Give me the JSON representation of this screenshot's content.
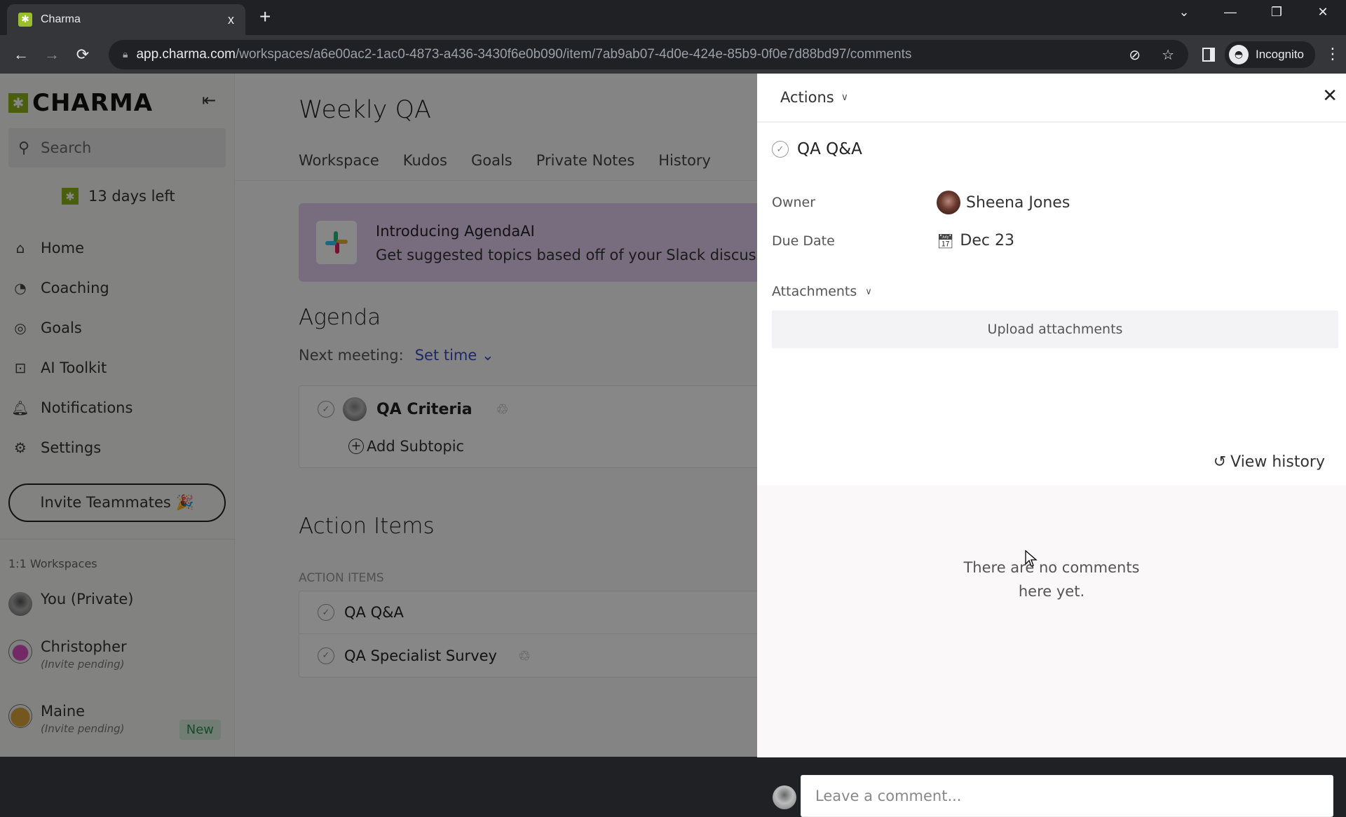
{
  "browser": {
    "tab_title": "Charma",
    "tab_close": "x",
    "new_tab": "+",
    "url_host": "app.charma.com",
    "url_path": "/workspaces/a6e00ac2-1ac0-4873-a436-3430f6e0b090/item/7ab9ab07-4d0e-424e-85b9-0f0e7d88bd97/comments",
    "profile_label": "Incognito",
    "window_controls": {
      "tabsearch": "⌄",
      "minimize": "—",
      "restore": "❐",
      "close": "✕"
    },
    "nav": {
      "back": "←",
      "forward": "→",
      "reload": "⟳"
    },
    "icons": {
      "eye_off": "⊘",
      "star": "☆",
      "menu": "⋮"
    }
  },
  "sidebar": {
    "logo": "CHARMA",
    "collapse_icon": "⇤",
    "search_placeholder": "Search",
    "trial": "13 days left",
    "nav_items": [
      {
        "label": "Home",
        "icon": "⌂"
      },
      {
        "label": "Coaching",
        "icon": "◔"
      },
      {
        "label": "Goals",
        "icon": "◎"
      },
      {
        "label": "AI Toolkit",
        "icon": "⊡"
      },
      {
        "label": "Notifications",
        "icon": "🔔︎"
      },
      {
        "label": "Settings",
        "icon": "⚙"
      }
    ],
    "invite_button": "Invite Teammates 🎉",
    "workspaces_heading": "1:1 Workspaces",
    "workspaces": [
      {
        "name": "You (Private)",
        "sub": "",
        "badge": "",
        "avatar_color": "#8a8a8a"
      },
      {
        "name": "Christopher",
        "sub": "(Invite pending)",
        "badge": "",
        "avatar_color": "#d94fc1"
      },
      {
        "name": "Maine",
        "sub": "(Invite pending)",
        "badge": "New",
        "avatar_color": "#d9a43a"
      }
    ]
  },
  "main": {
    "title": "Weekly QA",
    "tabs": [
      "Workspace",
      "Kudos",
      "Goals",
      "Private Notes",
      "History"
    ],
    "banner": {
      "title": "Introducing AgendaAI",
      "subtitle": "Get suggested topics based off of your Slack discussions"
    },
    "agenda": {
      "heading": "Agenda",
      "next_meeting_label": "Next meeting:",
      "next_meeting_value": "Set time",
      "topics": [
        {
          "title": "QA Criteria",
          "recurring": true
        }
      ],
      "add_subtopic": "Add Subtopic"
    },
    "action_items": {
      "heading": "Action Items",
      "section_label": "ACTION ITEMS",
      "items": [
        {
          "title": "QA Q&A",
          "recurring": false
        },
        {
          "title": "QA Specialist Survey",
          "recurring": true
        }
      ]
    }
  },
  "panel": {
    "actions_label": "Actions",
    "close_icon": "✕",
    "item_title": "QA Q&A",
    "owner_label": "Owner",
    "owner_name": "Sheena Jones",
    "due_label": "Due Date",
    "due_value": "Dec 23",
    "attachments_label": "Attachments",
    "upload_label": "Upload attachments",
    "view_history": "View history",
    "empty_comments_line1": "There are no comments",
    "empty_comments_line2": "here yet.",
    "comment_placeholder": "Leave a comment..."
  },
  "colors": {
    "brand_green": "#8fb21a",
    "link_blue": "#3b4cc0",
    "banner_bg": "#e3ccf0",
    "new_badge": "#2f8a4c"
  }
}
